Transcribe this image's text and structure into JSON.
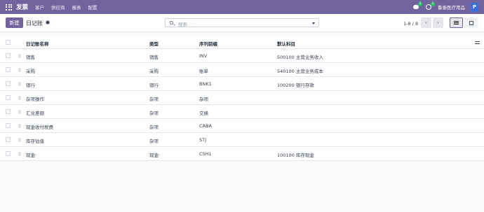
{
  "navbar": {
    "app_title": "发票",
    "menu": [
      "客户",
      "供应商",
      "报表",
      "配置"
    ],
    "chat_badge": "5",
    "activity_badge": "1",
    "company": "鲁泰医疗用品",
    "avatar_letter": "P"
  },
  "control": {
    "new_label": "新建",
    "breadcrumb": "日记账",
    "search_placeholder": "搜索...",
    "pager": "1-8 / 8",
    "prev": "‹",
    "next": "›"
  },
  "table": {
    "headers": [
      "日记账名称",
      "类型",
      "序列前缀",
      "默认科目"
    ],
    "rows": [
      {
        "name": "销售",
        "type": "销售",
        "prefix": "INV",
        "account": "500100 主营业务收入"
      },
      {
        "name": "采购",
        "type": "采购",
        "prefix": "账单",
        "account": "540100 主营业务成本"
      },
      {
        "name": "银行",
        "type": "银行",
        "prefix": "BNK1",
        "account": "100200 银行存款"
      },
      {
        "name": "杂项操作",
        "type": "杂项",
        "prefix": "杂项",
        "account": ""
      },
      {
        "name": "汇兑差额",
        "type": "杂项",
        "prefix": "交换",
        "account": ""
      },
      {
        "name": "现金收付税费",
        "type": "杂项",
        "prefix": "CABA",
        "account": ""
      },
      {
        "name": "库存估值",
        "type": "杂项",
        "prefix": "STJ",
        "account": ""
      },
      {
        "name": "现金",
        "type": "现金",
        "prefix": "CSH1",
        "account": "100100 库存现金"
      }
    ]
  },
  "colors": {
    "brand": "#71639e",
    "badge": "#22c55e",
    "avatar": "#3b6fd8"
  }
}
